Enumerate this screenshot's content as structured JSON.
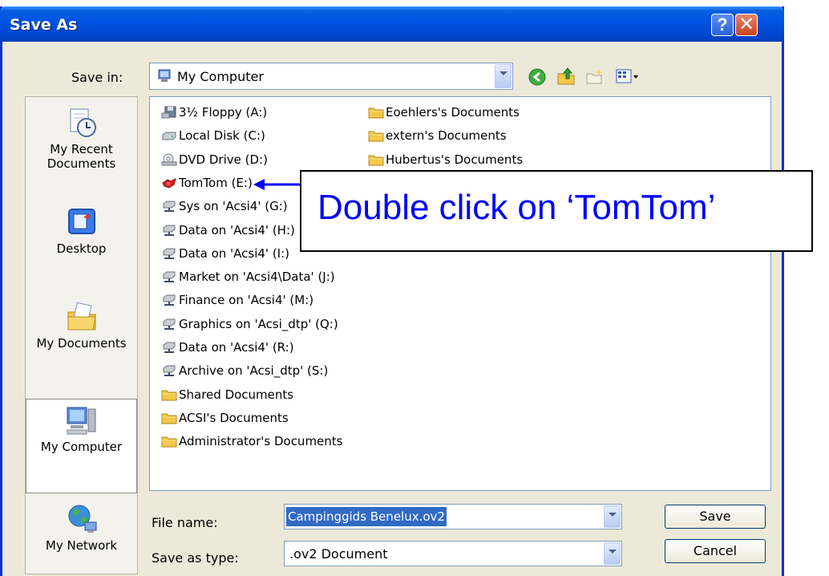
{
  "window": {
    "title": "Save As"
  },
  "toolbar": {
    "save_in_label": "Save in:",
    "save_in_value": "My Computer"
  },
  "places": [
    {
      "label": "My Recent Documents",
      "icon": "recent-documents-icon"
    },
    {
      "label": "Desktop",
      "icon": "desktop-icon"
    },
    {
      "label": "My Documents",
      "icon": "my-documents-icon"
    },
    {
      "label": "My Computer",
      "icon": "my-computer-icon",
      "selected": true
    },
    {
      "label": "My Network",
      "icon": "my-network-icon"
    }
  ],
  "files_col1": [
    {
      "label": "3½ Floppy (A:)",
      "icon": "floppy-icon"
    },
    {
      "label": "Local Disk (C:)",
      "icon": "disk-icon"
    },
    {
      "label": "DVD Drive (D:)",
      "icon": "dvd-icon"
    },
    {
      "label": "TomTom (E:)",
      "icon": "tomtom-drive-icon"
    },
    {
      "label": "Sys on 'Acsi4' (G:)",
      "icon": "network-drive-icon"
    },
    {
      "label": "Data on 'Acsi4' (H:)",
      "icon": "network-drive-icon"
    },
    {
      "label": "Data on 'Acsi4' (I:)",
      "icon": "network-drive-icon"
    },
    {
      "label": "Market on 'Acsi4\\Data' (J:)",
      "icon": "network-drive-icon"
    },
    {
      "label": "Finance on 'Acsi4' (M:)",
      "icon": "network-drive-icon"
    },
    {
      "label": "Graphics on 'Acsi_dtp' (Q:)",
      "icon": "network-drive-icon"
    },
    {
      "label": "Data on 'Acsi4' (R:)",
      "icon": "network-drive-icon"
    },
    {
      "label": "Archive on 'Acsi_dtp' (S:)",
      "icon": "network-drive-icon"
    },
    {
      "label": "Shared Documents",
      "icon": "folder-icon"
    },
    {
      "label": "ACSI's Documents",
      "icon": "folder-icon"
    },
    {
      "label": "Administrator's Documents",
      "icon": "folder-icon"
    }
  ],
  "files_col2": [
    {
      "label": "Eoehlers's Documents",
      "icon": "folder-icon"
    },
    {
      "label": "extern's Documents",
      "icon": "folder-icon"
    },
    {
      "label": "Hubertus's Documents",
      "icon": "folder-icon"
    }
  ],
  "form": {
    "file_name_label": "File name:",
    "file_name_value": "Campinggids Benelux.ov2",
    "save_type_label": "Save as type:",
    "save_type_value": ".ov2 Document"
  },
  "buttons": {
    "save": "Save",
    "cancel": "Cancel"
  },
  "annotation": {
    "text": "Double click on ‘TomTom’",
    "color": "#0000ff"
  },
  "colors": {
    "titlebar": "#0054e3",
    "dialog_bg": "#ece9d8",
    "selection": "#316ac5"
  }
}
